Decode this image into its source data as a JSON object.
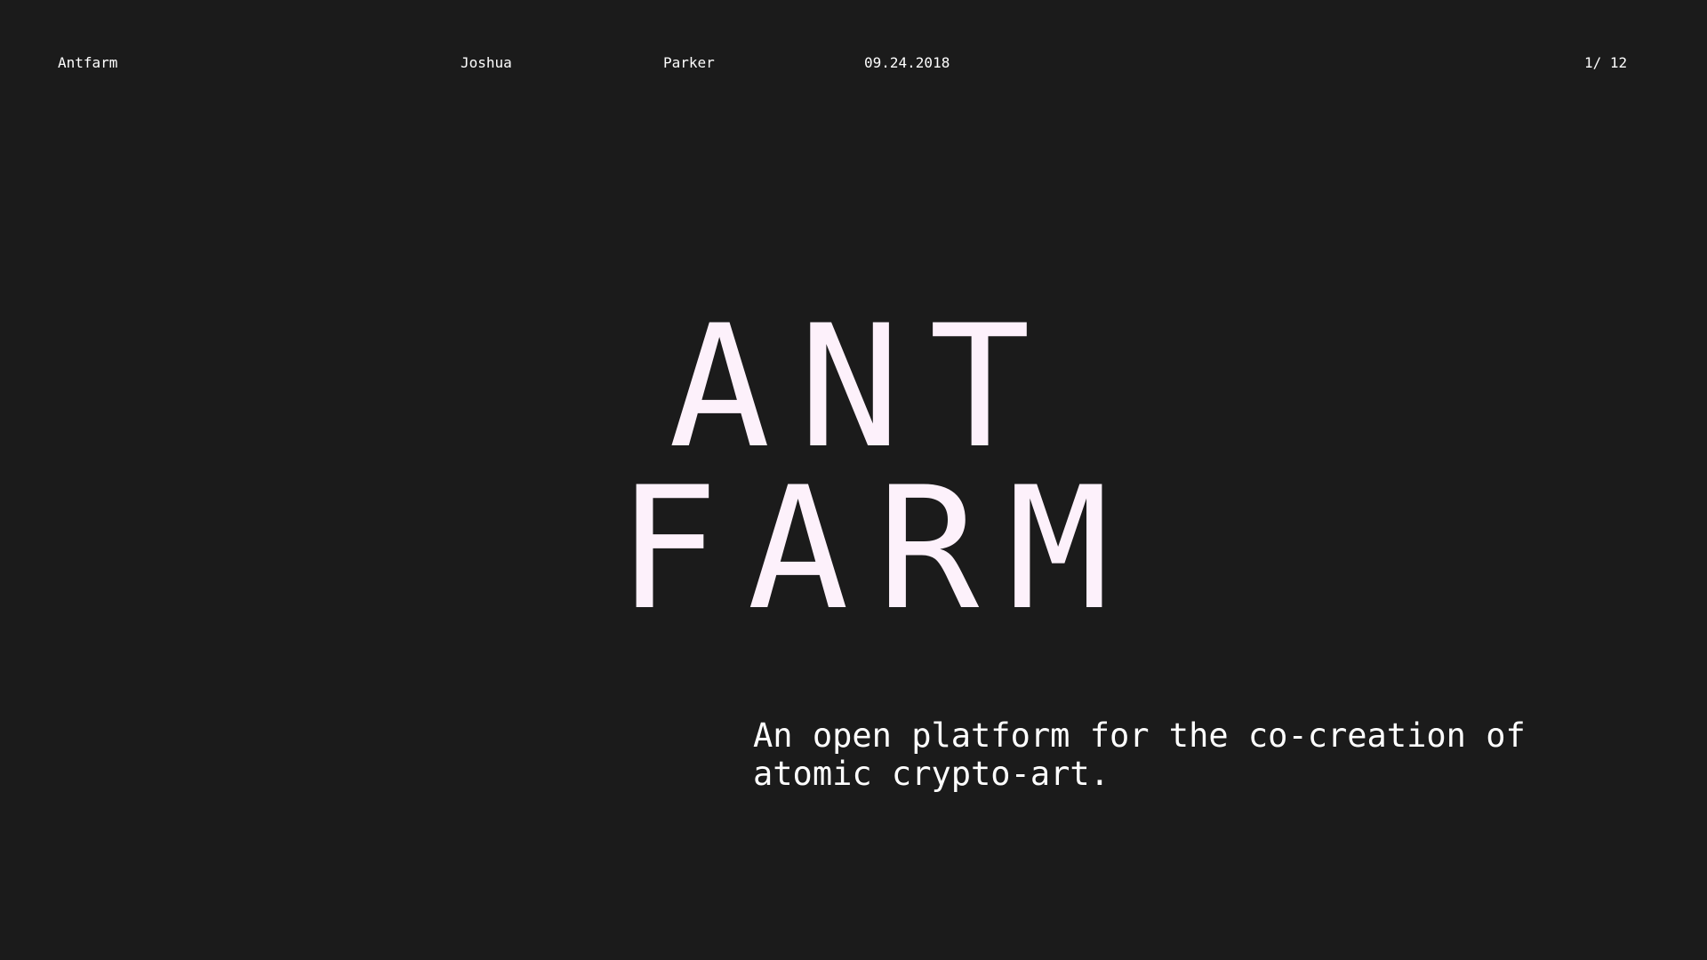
{
  "header": {
    "app_name": "Antfarm",
    "first_name": "Joshua",
    "last_name": "Parker",
    "date": "09.24.2018",
    "page_indicator": "1/ 12"
  },
  "hero": {
    "title_line_1": "ANT",
    "title_line_2": "FARM",
    "tagline": "An open platform for the co-creation of atomic crypto-art."
  },
  "colors": {
    "background": "#1b1b1b",
    "title": "#fdf1fb",
    "text": "#ffffff"
  }
}
